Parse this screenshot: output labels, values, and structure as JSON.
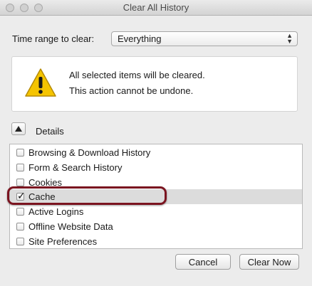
{
  "window": {
    "title": "Clear All History"
  },
  "time_range": {
    "label": "Time range to clear:",
    "selected": "Everything",
    "arrows": "▲▼"
  },
  "warning": {
    "icon": "warning-triangle-icon",
    "line1": "All selected items will be cleared.",
    "line2": "This action cannot be undone."
  },
  "details": {
    "label": "Details",
    "expanded": true
  },
  "items": [
    {
      "label": "Browsing & Download History",
      "checked": false
    },
    {
      "label": "Form & Search History",
      "checked": false
    },
    {
      "label": "Cookies",
      "checked": false
    },
    {
      "label": "Cache",
      "checked": true
    },
    {
      "label": "Active Logins",
      "checked": false
    },
    {
      "label": "Offline Website Data",
      "checked": false
    },
    {
      "label": "Site Preferences",
      "checked": false
    }
  ],
  "buttons": {
    "cancel": "Cancel",
    "clear_now": "Clear Now"
  },
  "colors": {
    "highlight": "#7b1420",
    "warning_yellow": "#f5c400"
  }
}
